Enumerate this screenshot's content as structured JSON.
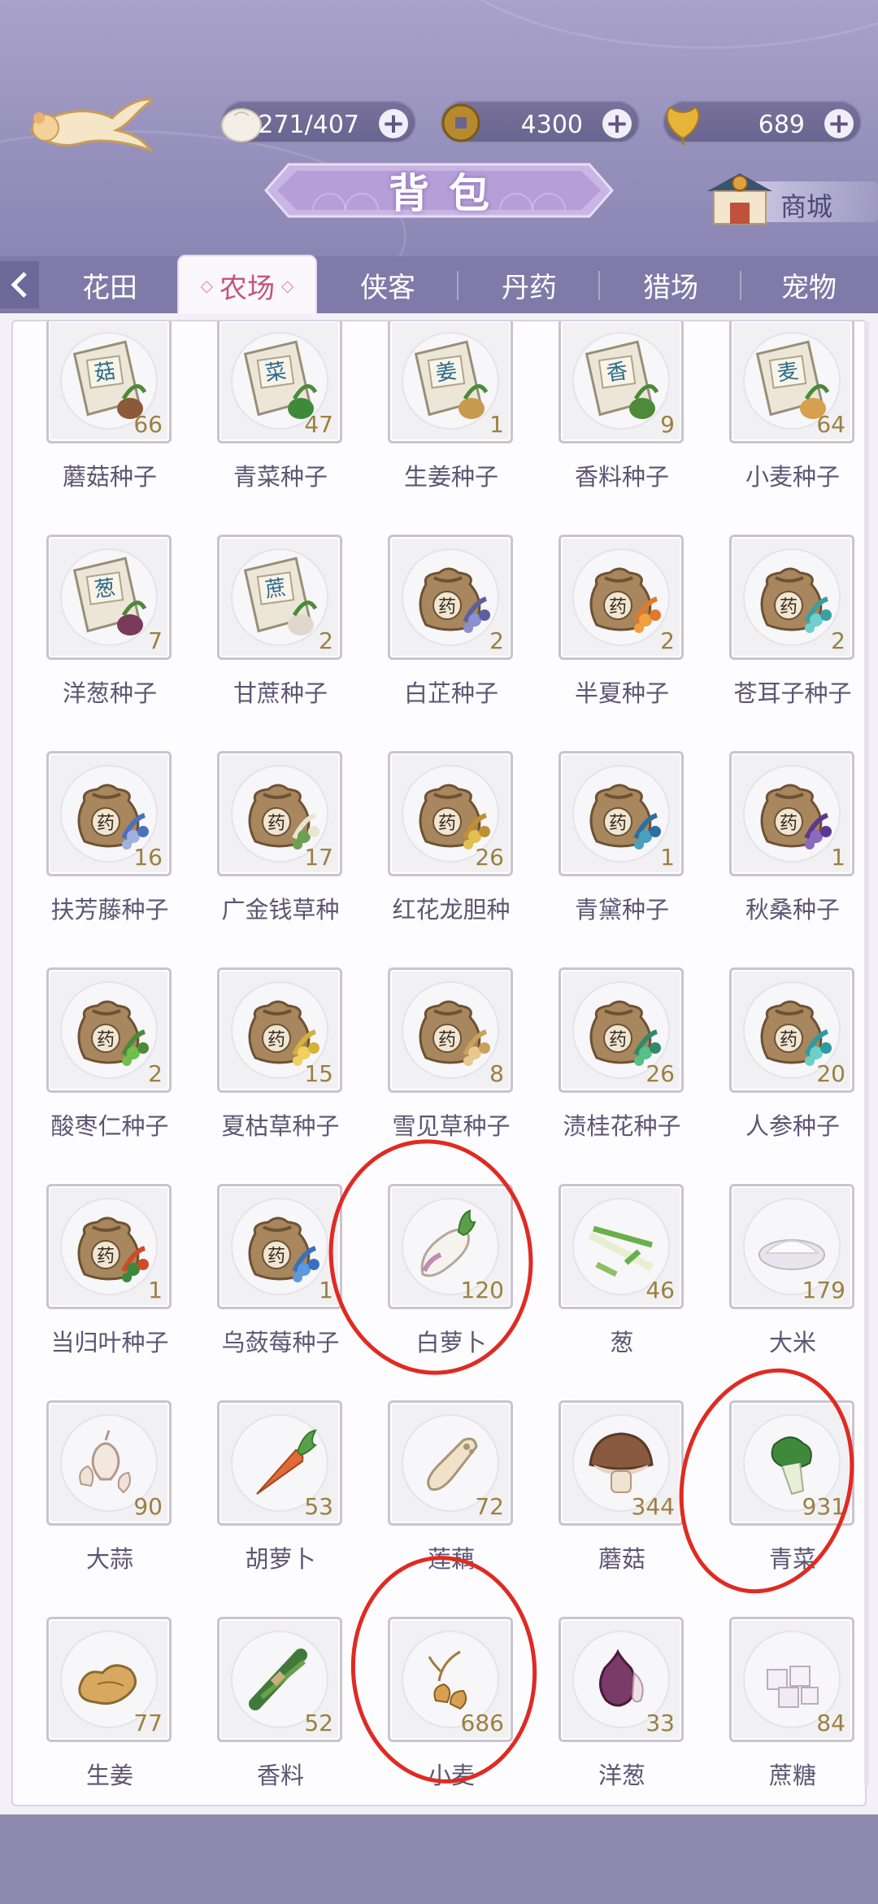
{
  "header": {
    "title": "背包",
    "shop_label": "商城",
    "resources": [
      {
        "name": "stamina",
        "icon": "bun-icon",
        "value": "271/407"
      },
      {
        "name": "copper",
        "icon": "coin-icon",
        "value": "4300"
      },
      {
        "name": "ginkgo",
        "icon": "ginkgo-leaf-icon",
        "value": "689"
      }
    ]
  },
  "tabs": [
    {
      "label": "花田",
      "active": false
    },
    {
      "label": "农场",
      "active": true
    },
    {
      "label": "侠客",
      "active": false
    },
    {
      "label": "丹药",
      "active": false
    },
    {
      "label": "猎场",
      "active": false
    },
    {
      "label": "宠物",
      "active": false
    }
  ],
  "items": [
    {
      "name": "蘑菇种子",
      "qty": "66",
      "icon": "seed-bag-icon",
      "mark": "菇"
    },
    {
      "name": "青菜种子",
      "qty": "47",
      "icon": "seed-bag-icon",
      "mark": "菜"
    },
    {
      "name": "生姜种子",
      "qty": "1",
      "icon": "seed-bag-icon",
      "mark": "姜"
    },
    {
      "name": "香料种子",
      "qty": "9",
      "icon": "seed-bag-icon",
      "mark": "香"
    },
    {
      "name": "小麦种子",
      "qty": "64",
      "icon": "seed-bag-icon",
      "mark": "麦"
    },
    {
      "name": "洋葱种子",
      "qty": "7",
      "icon": "seed-bag-icon",
      "mark": "葱"
    },
    {
      "name": "甘蔗种子",
      "qty": "2",
      "icon": "seed-bag-icon",
      "mark": "蔗"
    },
    {
      "name": "白芷种子",
      "qty": "2",
      "icon": "herb-bag-icon",
      "mark": "药"
    },
    {
      "name": "半夏种子",
      "qty": "2",
      "icon": "herb-bag-icon",
      "mark": "药"
    },
    {
      "name": "苍耳子种子",
      "qty": "2",
      "icon": "herb-bag-icon",
      "mark": "药"
    },
    {
      "name": "扶芳藤种子",
      "qty": "16",
      "icon": "herb-bag-icon",
      "mark": "药"
    },
    {
      "name": "广金钱草种",
      "qty": "17",
      "icon": "herb-bag-icon",
      "mark": "药"
    },
    {
      "name": "红花龙胆种",
      "qty": "26",
      "icon": "herb-bag-icon",
      "mark": "药"
    },
    {
      "name": "青黛种子",
      "qty": "1",
      "icon": "herb-bag-icon",
      "mark": "药"
    },
    {
      "name": "秋桑种子",
      "qty": "1",
      "icon": "herb-bag-icon",
      "mark": "药"
    },
    {
      "name": "酸枣仁种子",
      "qty": "2",
      "icon": "herb-bag-icon",
      "mark": "药"
    },
    {
      "name": "夏枯草种子",
      "qty": "15",
      "icon": "herb-bag-icon",
      "mark": "药"
    },
    {
      "name": "雪见草种子",
      "qty": "8",
      "icon": "herb-bag-icon",
      "mark": "药"
    },
    {
      "name": "渍桂花种子",
      "qty": "26",
      "icon": "herb-bag-icon",
      "mark": "药"
    },
    {
      "name": "人参种子",
      "qty": "20",
      "icon": "herb-bag-icon",
      "mark": "药"
    },
    {
      "name": "当归叶种子",
      "qty": "1",
      "icon": "herb-bag-icon",
      "mark": "药"
    },
    {
      "name": "乌蔹莓种子",
      "qty": "1",
      "icon": "herb-bag-icon",
      "mark": "药"
    },
    {
      "name": "白萝卜",
      "qty": "120",
      "icon": "radish-icon",
      "mark": ""
    },
    {
      "name": "葱",
      "qty": "46",
      "icon": "scallion-icon",
      "mark": ""
    },
    {
      "name": "大米",
      "qty": "179",
      "icon": "rice-icon",
      "mark": ""
    },
    {
      "name": "大蒜",
      "qty": "90",
      "icon": "garlic-icon",
      "mark": ""
    },
    {
      "name": "胡萝卜",
      "qty": "53",
      "icon": "carrot-icon",
      "mark": ""
    },
    {
      "name": "莲藕",
      "qty": "72",
      "icon": "lotus-root-icon",
      "mark": ""
    },
    {
      "name": "蘑菇",
      "qty": "344",
      "icon": "mushroom-icon",
      "mark": ""
    },
    {
      "name": "青菜",
      "qty": "931",
      "icon": "greens-icon",
      "mark": ""
    },
    {
      "name": "生姜",
      "qty": "77",
      "icon": "ginger-icon",
      "mark": ""
    },
    {
      "name": "香料",
      "qty": "52",
      "icon": "spice-icon",
      "mark": ""
    },
    {
      "name": "小麦",
      "qty": "686",
      "icon": "wheat-icon",
      "mark": ""
    },
    {
      "name": "洋葱",
      "qty": "33",
      "icon": "onion-icon",
      "mark": ""
    },
    {
      "name": "蔗糖",
      "qty": "84",
      "icon": "sugar-cube-icon",
      "mark": ""
    }
  ],
  "colors": {
    "annotation_red": "#e02a22",
    "active_tab_text": "#c4557a",
    "qty_text": "#9b8040"
  }
}
